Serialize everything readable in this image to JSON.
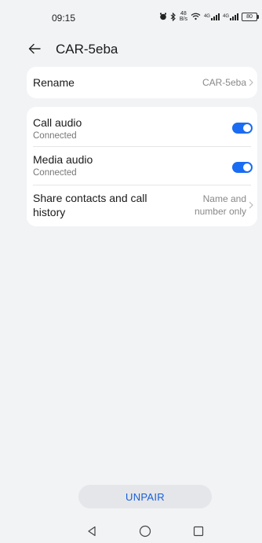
{
  "status_bar": {
    "time": "09:15",
    "speed_top": "48",
    "speed_bottom": "B/s",
    "signal1_label": "4G",
    "signal2_label": "4G",
    "battery": "80"
  },
  "header": {
    "title": "CAR-5eba"
  },
  "rename": {
    "label": "Rename",
    "value": "CAR-5eba"
  },
  "settings": {
    "call_audio": {
      "label": "Call audio",
      "status": "Connected",
      "enabled": true
    },
    "media_audio": {
      "label": "Media audio",
      "status": "Connected",
      "enabled": true
    },
    "share_contacts": {
      "label_line1": "Share contacts and call",
      "label_line2": "history",
      "value_line1": "Name and",
      "value_line2": "number only"
    }
  },
  "actions": {
    "unpair_label": "UNPAIR"
  },
  "colors": {
    "accent": "#1a6cf2",
    "background": "#f1f3f5"
  }
}
